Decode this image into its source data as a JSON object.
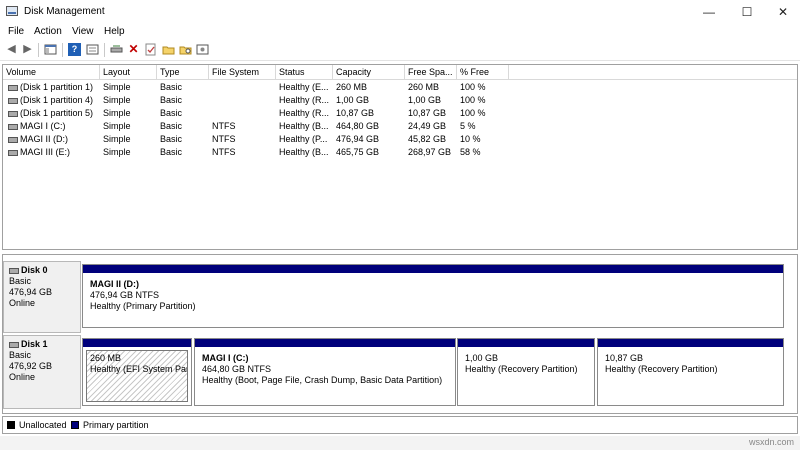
{
  "window": {
    "title": "Disk Management",
    "minimize": "—",
    "maximize": "☐",
    "close": "✕"
  },
  "menu": [
    "File",
    "Action",
    "View",
    "Help"
  ],
  "toolbar": {
    "icons": [
      "back-icon",
      "forward-icon",
      "show-hide-console-tree-icon",
      "help-icon",
      "properties-icon",
      "connect-disk-icon",
      "delete-icon",
      "check-icon",
      "folder-open-icon",
      "folder-search-icon",
      "settings-icon"
    ],
    "colors": {
      "delete": "#c00000",
      "help": "#1f5fb5"
    }
  },
  "volumes": {
    "columns": [
      "Volume",
      "Layout",
      "Type",
      "File System",
      "Status",
      "Capacity",
      "Free Spa...",
      "% Free"
    ],
    "rows": [
      [
        "(Disk 1 partition 1)",
        "Simple",
        "Basic",
        "",
        "Healthy (E...",
        "260 MB",
        "260 MB",
        "100 %"
      ],
      [
        "(Disk 1 partition 4)",
        "Simple",
        "Basic",
        "",
        "Healthy (R...",
        "1,00 GB",
        "1,00 GB",
        "100 %"
      ],
      [
        "(Disk 1 partition 5)",
        "Simple",
        "Basic",
        "",
        "Healthy (R...",
        "10,87 GB",
        "10,87 GB",
        "100 %"
      ],
      [
        "MAGI I (C:)",
        "Simple",
        "Basic",
        "NTFS",
        "Healthy (B...",
        "464,80 GB",
        "24,49 GB",
        "5 %"
      ],
      [
        "MAGI II (D:)",
        "Simple",
        "Basic",
        "NTFS",
        "Healthy (P...",
        "476,94 GB",
        "45,82 GB",
        "10 %"
      ],
      [
        "MAGI III (E:)",
        "Simple",
        "Basic",
        "NTFS",
        "Healthy (B...",
        "465,75 GB",
        "268,97 GB",
        "58 %"
      ]
    ]
  },
  "disks": [
    {
      "name": "Disk 0",
      "type": "Basic",
      "size": "476,94 GB",
      "state": "Online",
      "partitions": [
        {
          "name": "MAGI II  (D:)",
          "detail": "476,94 GB NTFS",
          "status": "Healthy (Primary Partition)"
        }
      ]
    },
    {
      "name": "Disk 1",
      "type": "Basic",
      "size": "476,92 GB",
      "state": "Online",
      "partitions": [
        {
          "name": "",
          "detail": "260 MB",
          "status": "Healthy (EFI System Partition)"
        },
        {
          "name": "MAGI I  (C:)",
          "detail": "464,80 GB NTFS",
          "status": "Healthy (Boot, Page File, Crash Dump, Basic Data Partition)"
        },
        {
          "name": "",
          "detail": "1,00 GB",
          "status": "Healthy (Recovery Partition)"
        },
        {
          "name": "",
          "detail": "10,87 GB",
          "status": "Healthy (Recovery Partition)"
        }
      ]
    }
  ],
  "legend": {
    "unallocated": "Unallocated",
    "primary": "Primary partition",
    "colors": {
      "unallocated": "#000000",
      "primary": "#00007b"
    }
  },
  "watermark": "wsxdn.com"
}
